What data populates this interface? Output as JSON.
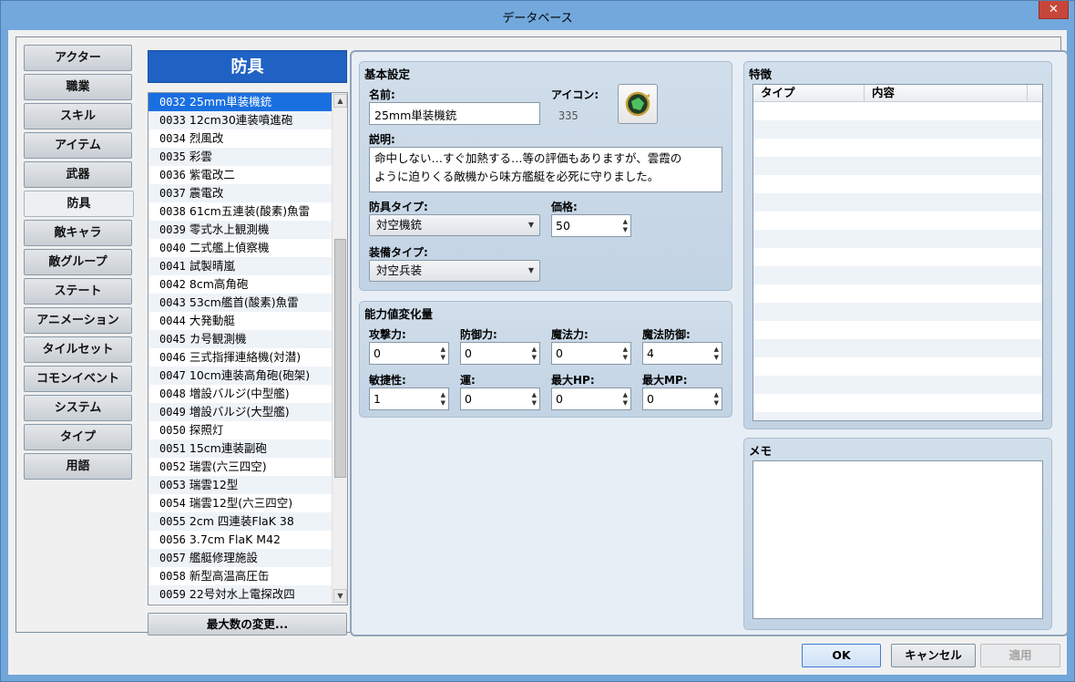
{
  "window": {
    "title": "データベース",
    "close_glyph": "✕"
  },
  "categories": [
    {
      "label": "アクター",
      "active": false
    },
    {
      "label": "職業",
      "active": false
    },
    {
      "label": "スキル",
      "active": false
    },
    {
      "label": "アイテム",
      "active": false
    },
    {
      "label": "武器",
      "active": false
    },
    {
      "label": "防具",
      "active": true
    },
    {
      "label": "敵キャラ",
      "active": false
    },
    {
      "label": "敵グループ",
      "active": false
    },
    {
      "label": "ステート",
      "active": false
    },
    {
      "label": "アニメーション",
      "active": false
    },
    {
      "label": "タイルセット",
      "active": false
    },
    {
      "label": "コモンイベント",
      "active": false
    },
    {
      "label": "システム",
      "active": false
    },
    {
      "label": "タイプ",
      "active": false
    },
    {
      "label": "用語",
      "active": false
    }
  ],
  "list": {
    "header": "防具",
    "selected_index": 0,
    "items": [
      {
        "id": "0032",
        "name": "25mm単装機銃"
      },
      {
        "id": "0033",
        "name": "12cm30連装噴進砲"
      },
      {
        "id": "0034",
        "name": "烈風改"
      },
      {
        "id": "0035",
        "name": "彩雲"
      },
      {
        "id": "0036",
        "name": "紫電改二"
      },
      {
        "id": "0037",
        "name": "震電改"
      },
      {
        "id": "0038",
        "name": "61cm五連装(酸素)魚雷"
      },
      {
        "id": "0039",
        "name": "零式水上観測機"
      },
      {
        "id": "0040",
        "name": "二式艦上偵察機"
      },
      {
        "id": "0041",
        "name": "試製晴嵐"
      },
      {
        "id": "0042",
        "name": "8cm高角砲"
      },
      {
        "id": "0043",
        "name": "53cm艦首(酸素)魚雷"
      },
      {
        "id": "0044",
        "name": "大発動艇"
      },
      {
        "id": "0045",
        "name": "カ号観測機"
      },
      {
        "id": "0046",
        "name": "三式指揮連絡機(対潜)"
      },
      {
        "id": "0047",
        "name": "10cm連装高角砲(砲架)"
      },
      {
        "id": "0048",
        "name": "増設バルジ(中型艦)"
      },
      {
        "id": "0049",
        "name": "増設バルジ(大型艦)"
      },
      {
        "id": "0050",
        "name": "探照灯"
      },
      {
        "id": "0051",
        "name": "15cm連装副砲"
      },
      {
        "id": "0052",
        "name": "瑞雲(六三四空)"
      },
      {
        "id": "0053",
        "name": "瑞雲12型"
      },
      {
        "id": "0054",
        "name": "瑞雲12型(六三四空)"
      },
      {
        "id": "0055",
        "name": "2cm 四連装FlaK 38"
      },
      {
        "id": "0056",
        "name": "3.7cm FlaK M42"
      },
      {
        "id": "0057",
        "name": "艦艇修理施設"
      },
      {
        "id": "0058",
        "name": "新型高温高圧缶"
      },
      {
        "id": "0059",
        "name": "22号対水上電探改四"
      }
    ],
    "scroll_up": "▲",
    "scroll_down": "▼",
    "max_button": "最大数の変更..."
  },
  "basic": {
    "title": "基本設定",
    "name_label": "名前:",
    "name_value": "25mm単装機銃",
    "icon_label": "アイコン:",
    "icon_index": "335",
    "desc_label": "説明:",
    "desc_line1": "命中しない…すぐ加熱する…等の評価もありますが、雲霞の",
    "desc_line2": "ように迫りくる敵機から味方艦艇を必死に守りました。",
    "armor_type_label": "防具タイプ:",
    "armor_type_value": "対空機銃",
    "price_label": "価格:",
    "price_value": "50",
    "equip_type_label": "装備タイプ:",
    "equip_type_value": "対空兵装",
    "combo_arrow": "▼",
    "spin_up": "▲",
    "spin_down": "▼"
  },
  "params": {
    "title": "能力値変化量",
    "fields": [
      {
        "label": "攻撃力:",
        "value": "0"
      },
      {
        "label": "防御力:",
        "value": "0"
      },
      {
        "label": "魔法力:",
        "value": "0"
      },
      {
        "label": "魔法防御:",
        "value": "4"
      },
      {
        "label": "敏捷性:",
        "value": "1"
      },
      {
        "label": "運:",
        "value": "0"
      },
      {
        "label": "最大HP:",
        "value": "0"
      },
      {
        "label": "最大MP:",
        "value": "0"
      }
    ]
  },
  "traits": {
    "title": "特徴",
    "col_type": "タイプ",
    "col_content": "内容"
  },
  "memo": {
    "title": "メモ"
  },
  "buttons": {
    "ok": "OK",
    "cancel": "キャンセル",
    "apply": "適用"
  },
  "colors": {
    "accent": "#1f62c4",
    "selection": "#1a6fe0",
    "close": "#c7463a"
  }
}
